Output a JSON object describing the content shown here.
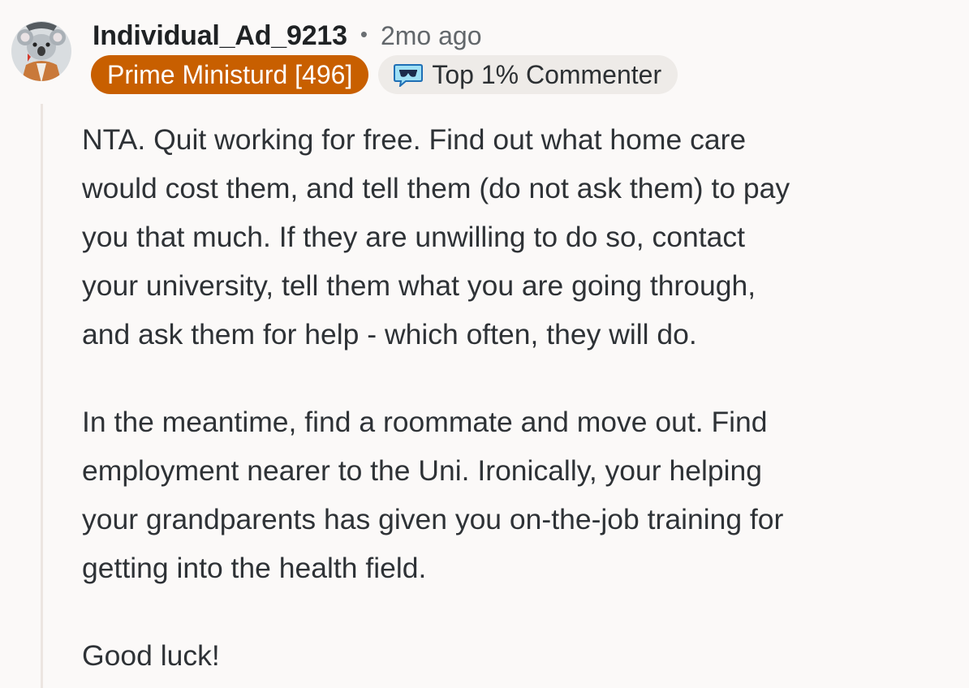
{
  "comment": {
    "username": "Individual_Ad_9213",
    "separator": "•",
    "time": "2mo ago",
    "flair": "Prime Ministurd [496]",
    "achievement": {
      "icon": "sunglasses-speech-bubble-icon",
      "label": "Top 1% Commenter"
    },
    "paragraphs": [
      [
        "NTA. Quit working for free. Find out what home care",
        "would cost them, and tell them (do not ask them) to pay",
        "you that much. If they are unwilling to do so, contact",
        "your university, tell them what you are going through,",
        "and ask them for help - which often, they will do."
      ],
      [
        "In the meantime, find a roommate and move out. Find",
        "employment nearer to the Uni. Ironically, your helping",
        "your grandparents has given you on-the-job training for",
        "getting into the health field."
      ],
      [
        "Good luck!"
      ]
    ]
  },
  "colors": {
    "background": "#fbf9f8",
    "flair_bg": "#c85f00",
    "achievement_bg": "#eeebe8",
    "thread_line": "#ece5e1"
  }
}
